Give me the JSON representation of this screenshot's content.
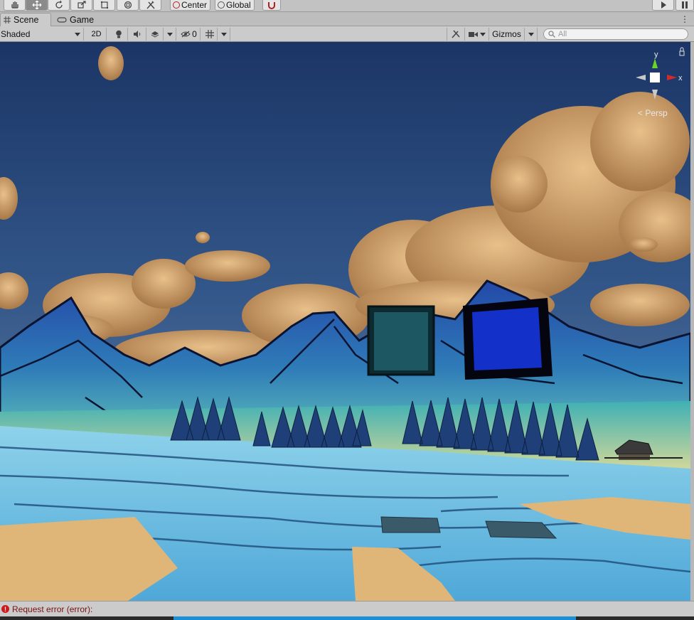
{
  "toolbar": {
    "tools": [
      {
        "name": "hand-tool",
        "icon": "hand-icon"
      },
      {
        "name": "move-tool",
        "icon": "move-icon"
      },
      {
        "name": "rotate-tool",
        "icon": "rotate-icon"
      },
      {
        "name": "scale-tool",
        "icon": "scale-icon"
      },
      {
        "name": "rect-tool",
        "icon": "rect-icon"
      },
      {
        "name": "transform-tool",
        "icon": "transform-icon"
      },
      {
        "name": "custom-tool",
        "icon": "tools-icon"
      }
    ],
    "pivot_label": "Center",
    "rotation_label": "Global",
    "play_icon": "play-icon",
    "pause_icon": "pause-icon"
  },
  "tabs": [
    {
      "label": "Scene",
      "icon": "grid-icon",
      "active": true
    },
    {
      "label": "Game",
      "icon": "gamepad-icon",
      "active": false
    }
  ],
  "scene_toolbar": {
    "draw_mode": "Shaded",
    "mode_2d": "2D",
    "hidden_count": "0",
    "gizmos_label": "Gizmos",
    "search_placeholder": "All"
  },
  "viewport": {
    "projection_label": "Persp",
    "axis_y": "y",
    "axis_x": "x",
    "colors": {
      "sky_top": "#1e3a6e",
      "sky_bottom": "#6a87a6",
      "cloud": "#d9a86a",
      "mountain": "#2451a8",
      "teal": "#2fa3a8",
      "water": "#6cc0e0",
      "sand": "#e0b877",
      "cube_teal": "#1b4e56",
      "cube_blue": "#1232c8"
    }
  },
  "status": {
    "message": "Request error (error):"
  }
}
